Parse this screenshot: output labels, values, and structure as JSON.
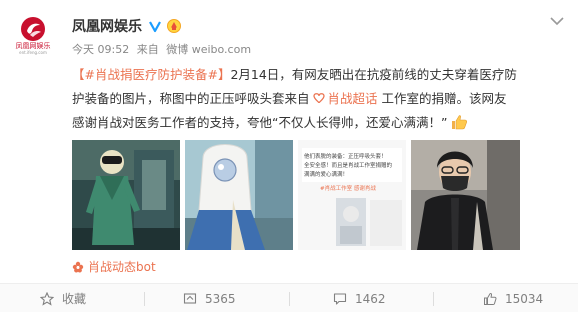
{
  "account": {
    "name": "凤凰网娱乐",
    "logo_text": "凤凰网娱乐",
    "logo_sub": "ent.ifeng.com"
  },
  "meta": {
    "time": "今天 09:52",
    "from_label": "来自",
    "client": "微博 weibo.com"
  },
  "post": {
    "hashtag": "【#肖战捐医疗防护装备#】",
    "text_1": "2月14日，有网友晒出在抗疫前线的丈夫穿着医疗防护装备的图片，称图中的正压呼吸头套来自",
    "super_topic": "肖战超话",
    "text_2": "工作室的捐赠。该网友感谢肖战对医务工作者的支持，夸他“不仅人长得帅，还爱心满满！”"
  },
  "images": {
    "screenshot_lines": [
      "他们表脱的装备：正压呼吸头套！",
      "全安全感！而且是肖战工作室捐赠的",
      "满满的爱心满满！"
    ],
    "screenshot_tag": "#肖战工作室 感谢肖战"
  },
  "source": {
    "label": "肖战动态bot"
  },
  "footer": {
    "favorite_label": "收藏",
    "repost_count": "5365",
    "comment_count": "1462",
    "like_count": "15034"
  },
  "colors": {
    "accent": "#eb7350",
    "verified": "#1a9dff",
    "brand_red": "#c8102e"
  }
}
